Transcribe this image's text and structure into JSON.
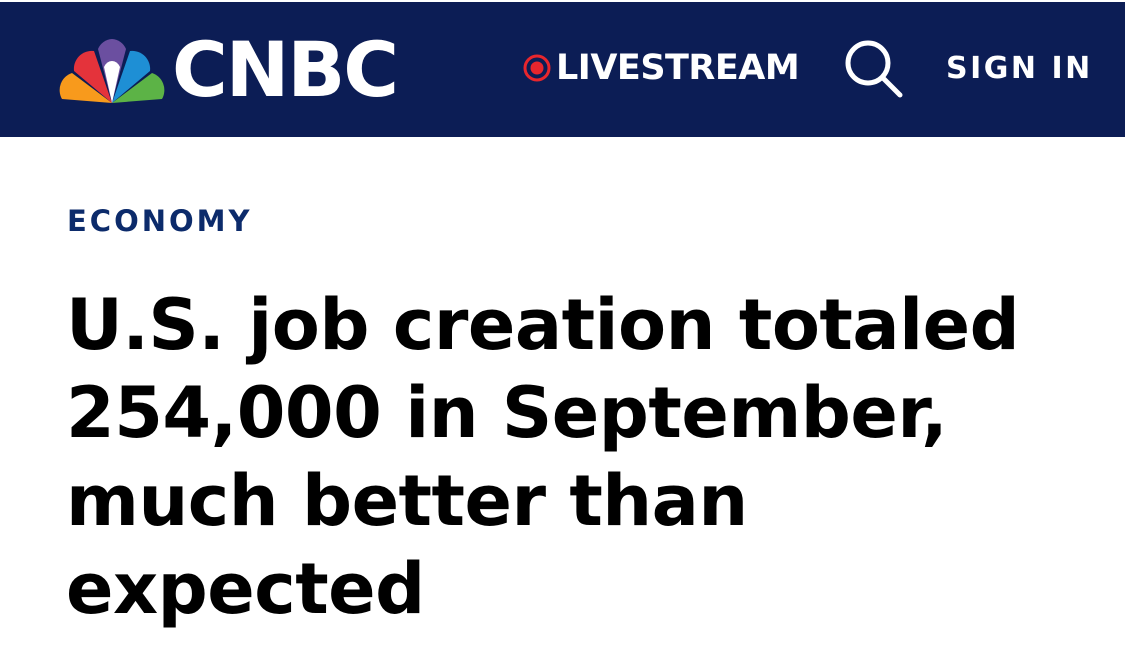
{
  "header": {
    "logo_text": "CNBC",
    "livestream_label": "LIVESTREAM",
    "search_icon": "search-icon",
    "sign_in_label": "SIGN IN",
    "colors": {
      "background": "#0c1d55",
      "live_dot": "#e8262d",
      "text": "#ffffff"
    }
  },
  "article": {
    "section": "ECONOMY",
    "headline": "U.S. job creation totaled 254,000 in September, much better than expected",
    "colors": {
      "section": "#0c2b6b",
      "headline": "#000000"
    }
  }
}
